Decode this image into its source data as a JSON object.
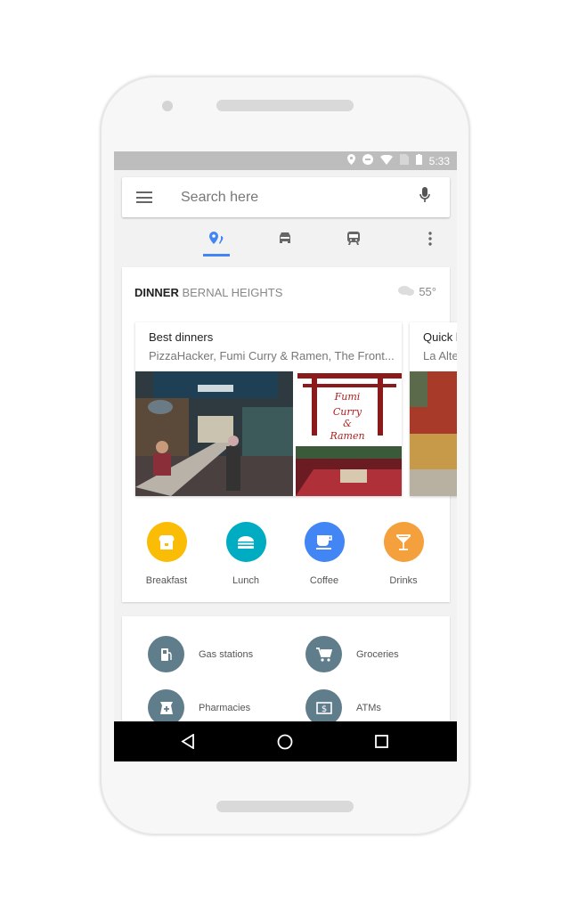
{
  "status_bar": {
    "time": "5:33",
    "icons": [
      "location-icon",
      "do-not-disturb-icon",
      "wifi-icon",
      "no-sim-icon",
      "battery-charging-icon"
    ]
  },
  "search": {
    "placeholder": "Search here",
    "menu_icon": "hamburger-icon",
    "mic_icon": "mic-icon"
  },
  "tabs": [
    {
      "icon": "explore-icon",
      "active": true
    },
    {
      "icon": "car-icon",
      "active": false
    },
    {
      "icon": "train-icon",
      "active": false
    },
    {
      "icon": "more-vert-icon",
      "active": false
    }
  ],
  "explore": {
    "meal": "DINNER",
    "neighborhood": "BERNAL HEIGHTS",
    "weather_icon": "cloud-icon",
    "temperature": "55°",
    "lists": [
      {
        "title": "Best dinners",
        "subtitle": "PizzaHacker, Fumi Curry & Ramen, The Front...",
        "sign_text": [
          "Fumi",
          "Curry",
          "&",
          "Ramen"
        ]
      },
      {
        "title": "Quick l",
        "subtitle": "La Alte"
      }
    ],
    "categories": [
      {
        "label": "Breakfast",
        "icon": "toast-icon",
        "color": "#fbbc05"
      },
      {
        "label": "Lunch",
        "icon": "burger-icon",
        "color": "#00acc1"
      },
      {
        "label": "Coffee",
        "icon": "coffee-icon",
        "color": "#4285f4"
      },
      {
        "label": "Drinks",
        "icon": "cocktail-icon",
        "color": "#f4a03c"
      }
    ]
  },
  "services": [
    {
      "label": "Gas stations",
      "icon": "gas-station-icon"
    },
    {
      "label": "Groceries",
      "icon": "cart-icon"
    },
    {
      "label": "Pharmacies",
      "icon": "pharmacy-icon"
    },
    {
      "label": "ATMs",
      "icon": "atm-icon"
    }
  ],
  "nav_bar": {
    "icons": [
      "back-icon",
      "home-icon",
      "recents-icon"
    ]
  }
}
